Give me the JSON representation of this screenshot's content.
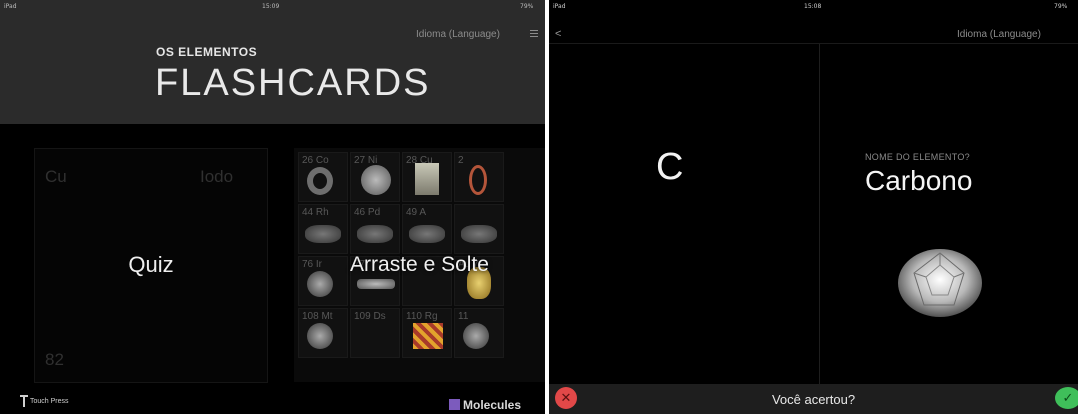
{
  "left": {
    "status": {
      "carrier": "iPad",
      "time": "15:09",
      "battery": "79%"
    },
    "language": "Idioma (Language)",
    "brand_small": "OS ELEMENTOS",
    "brand_big": "FLASHCARDS",
    "quiz": {
      "title": "Quiz",
      "tl": "Cu",
      "tr": "Iodo",
      "bl": "82"
    },
    "drag_drop": {
      "title": "Arraste e Solte",
      "cells": [
        {
          "label": "26 Co",
          "obj": "ring"
        },
        {
          "label": "27 Ni",
          "obj": "disc"
        },
        {
          "label": "28 Cu",
          "obj": "block"
        },
        {
          "label": "2",
          "obj": "coil"
        },
        {
          "label": "44 Rh",
          "obj": "rock"
        },
        {
          "label": "46 Pd",
          "obj": "rock"
        },
        {
          "label": "49 A",
          "obj": "rock"
        },
        {
          "label": "",
          "obj": "rock"
        },
        {
          "label": "76 Ir",
          "obj": "ball"
        },
        {
          "label": "77",
          "obj": "bar"
        },
        {
          "label": "",
          "obj": ""
        },
        {
          "label": "Au 7",
          "obj": "nugget"
        },
        {
          "label": "108 Mt",
          "obj": "ball"
        },
        {
          "label": "109 Ds",
          "obj": ""
        },
        {
          "label": "110 Rg",
          "obj": "tiles"
        },
        {
          "label": "11",
          "obj": "ball"
        }
      ]
    },
    "footer": {
      "publisher": "Touch Press",
      "molecules": "Molecules"
    }
  },
  "right": {
    "status": {
      "carrier": "iPad",
      "time": "15:08",
      "battery": "79%"
    },
    "back": "<",
    "language": "Idioma (Language)",
    "symbol": "C",
    "question_label": "NOME DO ELEMENTO?",
    "answer": "Carbono",
    "bottom_question": "Você acertou?",
    "no_icon": "✕",
    "yes_icon": "✓"
  },
  "colors": {
    "no": "#e14848",
    "yes": "#3fbf5a",
    "molecules": "#7c5bbd"
  }
}
